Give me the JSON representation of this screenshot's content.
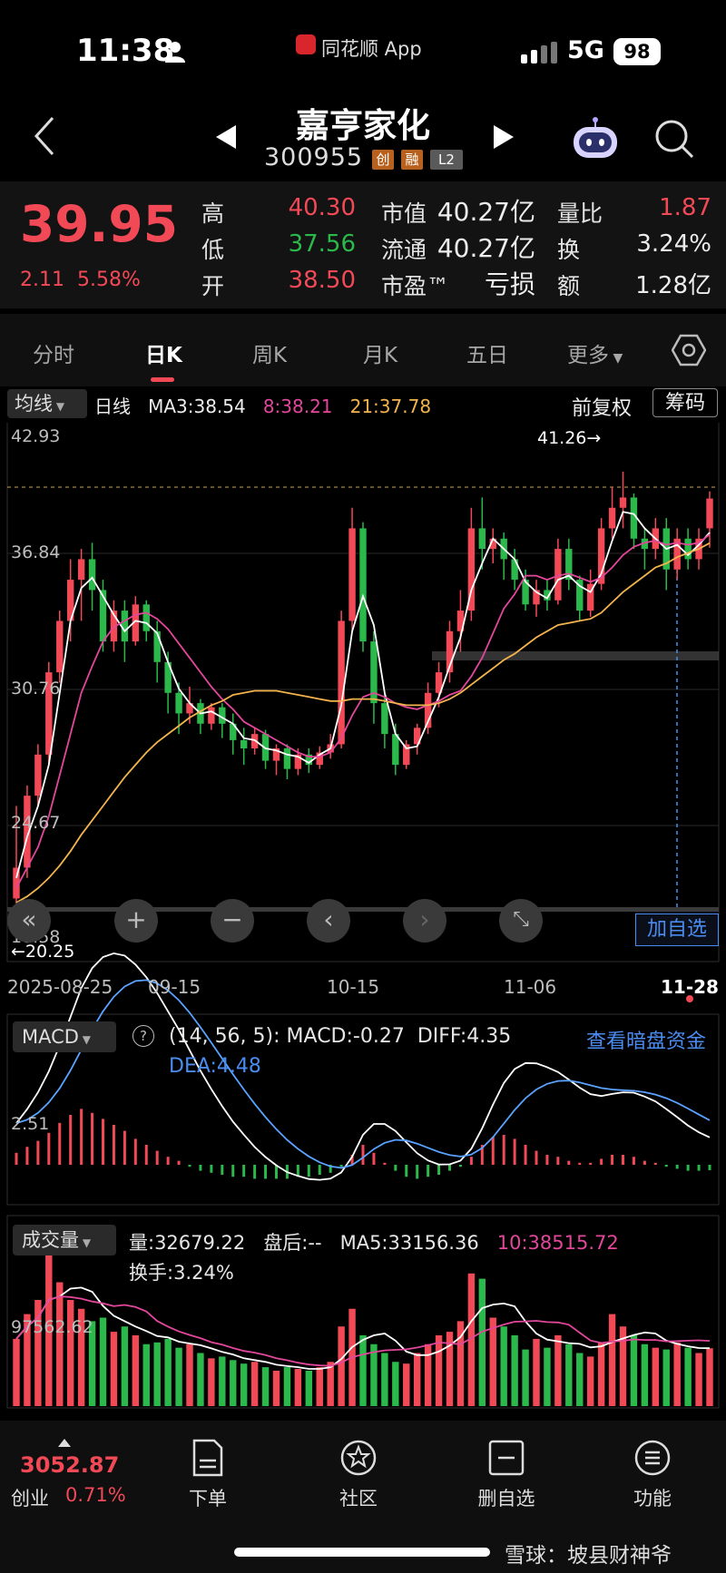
{
  "status_bar": {
    "time": "11:38",
    "app": "同花顺 App",
    "network": "5G",
    "battery": "98"
  },
  "header": {
    "stock_name": "嘉亨家化",
    "stock_code": "300955",
    "tags": [
      "创",
      "融",
      "L2"
    ]
  },
  "quote": {
    "price": "39.95",
    "change": "2.11",
    "change_pct": "5.58%",
    "rows": [
      {
        "l1": "高",
        "v1": "40.30",
        "c1": "#f24957",
        "l2": "市值",
        "v2": "40.27亿",
        "l3": "量比",
        "v3": "1.87",
        "c3": "#f24957"
      },
      {
        "l1": "低",
        "v1": "37.56",
        "c1": "#2ab94a",
        "l2": "流通",
        "v2": "40.27亿",
        "l3": "换",
        "v3": "3.24%",
        "c3": "#ededed"
      },
      {
        "l1": "开",
        "v1": "38.50",
        "c1": "#f24957",
        "l2": "市盈™",
        "v2": "亏损",
        "l3": "额",
        "v3": "1.28亿",
        "c3": "#ededed"
      }
    ]
  },
  "tabs": [
    "分时",
    "日K",
    "周K",
    "月K",
    "五日",
    "更多"
  ],
  "active_tab": "日K",
  "ma_row": {
    "selector": "均线",
    "type": "日线",
    "ma3": "MA3:38.54",
    "ma8": "8:38.21",
    "ma21": "21:37.78",
    "adjust": "前复权",
    "chips": "筹码"
  },
  "kline_chart": {
    "y_labels": [
      "42.93",
      "36.84",
      "30.76",
      "24.67",
      "18.58"
    ],
    "high_marker": "41.26→",
    "low_marker": "←20.25",
    "x_labels": [
      "2025-08-25",
      "09-15",
      "10-15",
      "11-06",
      "11-28"
    ],
    "add_watch": "加自选"
  },
  "macd": {
    "selector": "MACD",
    "params": "(14, 56, 5):",
    "macd": "MACD:-0.27",
    "diff": "DIFF:4.35",
    "dea": "DEA:4.48",
    "y_label": "2.51",
    "link": "查看暗盘资金"
  },
  "volume": {
    "selector": "成交量",
    "vol": "量:32679.22",
    "after": "盘后:--",
    "ma5": "MA5:33156.36",
    "ma10": "10:38515.72",
    "turnover": "换手:3.24%",
    "y_label": "97562.62"
  },
  "bottom_nav": {
    "index_value": "3052.87",
    "index_name": "创业",
    "index_change": "0.71%",
    "items": [
      "下单",
      "社区",
      "删自选",
      "功能"
    ]
  },
  "watermark": "雪球：坡县财神爷",
  "chart_data": {
    "type": "candlestick",
    "candles": [
      [
        20.5,
        22.0,
        20.25,
        25.0
      ],
      [
        22.0,
        25.5,
        21.5,
        26.0
      ],
      [
        25.5,
        27.5,
        25.0,
        28.0
      ],
      [
        27.5,
        31.5,
        27.0,
        32.0
      ],
      [
        31.5,
        34.0,
        31.0,
        34.5
      ],
      [
        34.0,
        36.0,
        33.0,
        37.0
      ],
      [
        36.0,
        37.0,
        34.0,
        37.5
      ],
      [
        37.0,
        35.5,
        34.5,
        37.8
      ],
      [
        35.5,
        33.0,
        32.5,
        36.0
      ],
      [
        33.0,
        34.5,
        32.5,
        35.0
      ],
      [
        34.5,
        33.0,
        32.0,
        35.0
      ],
      [
        33.0,
        34.8,
        32.8,
        35.2
      ],
      [
        34.8,
        33.5,
        33.0,
        35.0
      ],
      [
        33.5,
        32.0,
        31.0,
        34.0
      ],
      [
        32.0,
        30.5,
        29.5,
        32.5
      ],
      [
        30.5,
        29.5,
        28.5,
        31.0
      ],
      [
        29.5,
        30.0,
        29.0,
        30.8
      ],
      [
        30.0,
        29.0,
        28.5,
        30.2
      ],
      [
        29.0,
        29.8,
        28.7,
        30.0
      ],
      [
        29.8,
        29.0,
        28.3,
        30.0
      ],
      [
        29.0,
        28.2,
        27.5,
        29.5
      ],
      [
        28.2,
        27.8,
        27.0,
        28.8
      ],
      [
        27.8,
        28.5,
        27.5,
        28.8
      ],
      [
        28.5,
        27.2,
        26.8,
        28.7
      ],
      [
        27.2,
        27.8,
        26.5,
        28.0
      ],
      [
        27.8,
        26.8,
        26.3,
        28.0
      ],
      [
        26.8,
        27.5,
        26.5,
        27.8
      ],
      [
        27.5,
        27.0,
        26.6,
        27.8
      ],
      [
        27.0,
        27.6,
        26.8,
        27.9
      ],
      [
        27.6,
        28.0,
        27.3,
        28.5
      ],
      [
        28.0,
        34.0,
        27.8,
        34.5
      ],
      [
        34.0,
        38.5,
        33.5,
        39.5
      ],
      [
        38.5,
        33.0,
        32.5,
        38.8
      ],
      [
        33.0,
        30.0,
        29.0,
        33.5
      ],
      [
        30.0,
        28.5,
        27.8,
        30.5
      ],
      [
        28.5,
        27.0,
        26.5,
        29.0
      ],
      [
        27.0,
        28.0,
        26.8,
        28.2
      ],
      [
        28.0,
        28.8,
        27.5,
        29.0
      ],
      [
        28.8,
        30.5,
        28.5,
        31.0
      ],
      [
        30.5,
        31.5,
        29.8,
        32.0
      ],
      [
        31.5,
        33.5,
        31.0,
        34.0
      ],
      [
        33.5,
        34.5,
        32.5,
        35.5
      ],
      [
        34.5,
        38.5,
        34.0,
        39.5
      ],
      [
        38.5,
        37.5,
        36.5,
        40.0
      ],
      [
        37.5,
        38.0,
        36.8,
        38.5
      ],
      [
        38.0,
        37.0,
        36.0,
        38.3
      ],
      [
        37.0,
        36.0,
        35.5,
        37.5
      ],
      [
        36.0,
        34.8,
        34.5,
        36.5
      ],
      [
        34.8,
        35.5,
        34.2,
        36.0
      ],
      [
        35.5,
        35.0,
        34.5,
        36.0
      ],
      [
        35.0,
        37.5,
        34.8,
        38.0
      ],
      [
        37.5,
        36.0,
        35.5,
        38.0
      ],
      [
        36.0,
        34.5,
        34.0,
        36.2
      ],
      [
        34.5,
        35.8,
        34.2,
        36.5
      ],
      [
        35.8,
        38.5,
        35.5,
        39.0
      ],
      [
        38.5,
        39.5,
        38.0,
        40.5
      ],
      [
        39.5,
        40.0,
        38.5,
        41.26
      ],
      [
        40.0,
        38.0,
        37.5,
        40.2
      ],
      [
        38.0,
        37.5,
        36.5,
        38.5
      ],
      [
        37.5,
        38.5,
        37.0,
        39.0
      ],
      [
        38.5,
        36.5,
        35.5,
        39.0
      ],
      [
        36.5,
        38.0,
        36.0,
        38.5
      ],
      [
        38.0,
        37.0,
        36.5,
        38.5
      ],
      [
        37.0,
        38.0,
        36.5,
        38.5
      ],
      [
        38.5,
        39.95,
        37.56,
        40.3
      ]
    ],
    "ma3": [
      21.5,
      23.5,
      25,
      27,
      30.5,
      34,
      35.6,
      36.1,
      35.2,
      34.3,
      33.5,
      34,
      33.9,
      33.4,
      32,
      30.7,
      30,
      29.5,
      29.6,
      29.3,
      29,
      28.3,
      28.2,
      27.8,
      27.7,
      27.5,
      27.4,
      27.1,
      27.5,
      27.8,
      29.9,
      33.5,
      35.2,
      33.8,
      30.5,
      28.5,
      27.8,
      27.9,
      29.1,
      30.3,
      31.8,
      33.2,
      35.5,
      36.8,
      38,
      37.5,
      37,
      35.9,
      35.4,
      35.1,
      36,
      36.2,
      35.7,
      35.4,
      36.3,
      37.9,
      39.3,
      39.2,
      38.5,
      38,
      37.5,
      37.7,
      37.2,
      37.7,
      38.3
    ],
    "ma8": [
      21,
      22,
      23,
      24.5,
      26.5,
      28.5,
      30.5,
      31.8,
      33,
      33.7,
      34,
      34.3,
      34.4,
      34.1,
      33.6,
      32.9,
      32.2,
      31.5,
      30.8,
      30.2,
      29.7,
      29.1,
      28.8,
      28.5,
      28.2,
      27.9,
      27.6,
      27.4,
      27.4,
      27.6,
      28.3,
      29.4,
      30.3,
      30.5,
      30.3,
      30,
      29.8,
      29.7,
      29.9,
      30.1,
      30.4,
      30.6,
      31.3,
      32.2,
      33.4,
      34.6,
      35.3,
      36.2,
      36.2,
      36,
      36.2,
      36.3,
      36.1,
      35.9,
      36.1,
      36.6,
      37.2,
      37.6,
      37.8,
      37.9,
      37.7,
      37.8,
      37.7,
      37.8,
      38.2
    ],
    "ma21": [
      20.3,
      20.6,
      21,
      21.5,
      22.1,
      22.8,
      23.6,
      24.3,
      25,
      25.7,
      26.4,
      27,
      27.6,
      28.1,
      28.5,
      28.9,
      29.3,
      29.6,
      29.9,
      30.1,
      30.4,
      30.5,
      30.6,
      30.6,
      30.6,
      30.5,
      30.4,
      30.3,
      30.2,
      30.1,
      30.1,
      30.2,
      30.2,
      30.2,
      30.1,
      30,
      29.9,
      29.9,
      29.9,
      30,
      30.2,
      30.5,
      30.9,
      31.3,
      31.7,
      32.1,
      32.4,
      32.8,
      33.2,
      33.5,
      33.8,
      33.9,
      34,
      34.1,
      34.4,
      34.9,
      35.4,
      35.8,
      36.2,
      36.6,
      36.8,
      37.1,
      37.3,
      37.5,
      37.78
    ],
    "macd_hist": [
      0.6,
      0.9,
      1.2,
      1.6,
      2.1,
      2.5,
      2.8,
      2.6,
      2.3,
      2.0,
      1.7,
      1.3,
      1.0,
      0.7,
      0.4,
      0.2,
      -0.1,
      -0.3,
      -0.4,
      -0.5,
      -0.6,
      -0.6,
      -0.7,
      -0.7,
      -0.7,
      -0.7,
      -0.6,
      -0.6,
      -0.5,
      -0.4,
      -0.1,
      0.5,
      1.0,
      0.6,
      0.1,
      -0.3,
      -0.6,
      -0.7,
      -0.6,
      -0.5,
      -0.3,
      -0.1,
      0.4,
      1.0,
      1.4,
      1.5,
      1.3,
      1.0,
      0.7,
      0.5,
      0.4,
      0.2,
      0.1,
      0.1,
      0.3,
      0.5,
      0.5,
      0.4,
      0.2,
      0.1,
      -0.1,
      -0.2,
      -0.3,
      -0.3,
      -0.27
    ],
    "volume": [
      38000,
      52000,
      60000,
      90000,
      70000,
      60000,
      55000,
      48000,
      50000,
      42000,
      45000,
      40000,
      35000,
      36000,
      38000,
      33000,
      35000,
      30000,
      27000,
      28000,
      26000,
      24000,
      25000,
      22000,
      20000,
      22000,
      21000,
      20000,
      22000,
      25000,
      45000,
      55000,
      40000,
      35000,
      30000,
      25000,
      24000,
      30000,
      35000,
      40000,
      42000,
      48000,
      75000,
      72000,
      50000,
      45000,
      40000,
      32000,
      38000,
      33000,
      40000,
      35000,
      30000,
      28000,
      36000,
      52000,
      45000,
      40000,
      35000,
      33000,
      32000,
      36000,
      33000,
      30000,
      32679
    ]
  }
}
